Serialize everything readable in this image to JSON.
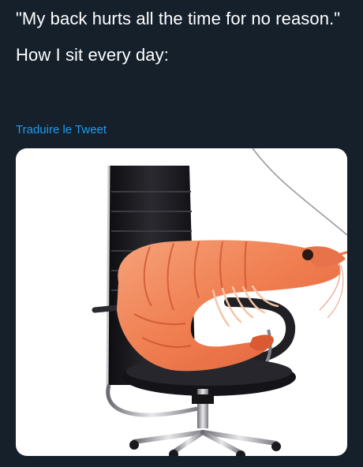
{
  "tweet": {
    "quote": "\"My back hurts all the time for no reason.\"",
    "caption": "How I sit every day:",
    "translate_label": "Traduire le Tweet"
  },
  "media": {
    "description_icon": "shrimp-in-office-chair-image"
  },
  "colors": {
    "background": "#15202b",
    "text": "#ffffff",
    "link": "#1d9bf0",
    "shrimp": "#f08a5d",
    "chair": "#1e1e22"
  }
}
